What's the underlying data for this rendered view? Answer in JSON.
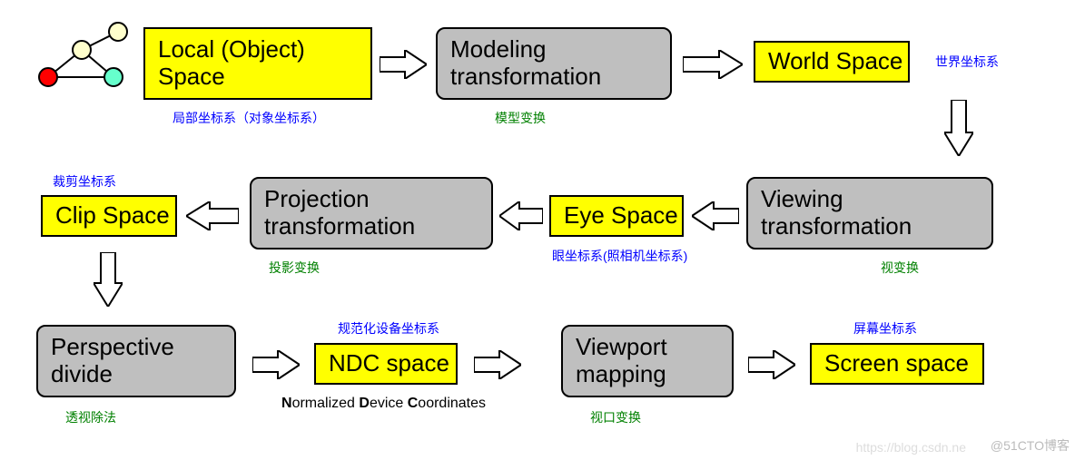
{
  "nodes": {
    "local": {
      "label": "Local (Object)\nSpace",
      "caption": "局部坐标系（对象坐标系）",
      "caption_color": "blue"
    },
    "modeling": {
      "label": "Modeling\ntransformation",
      "caption": "模型变换",
      "caption_color": "green"
    },
    "world": {
      "label": "World Space",
      "caption": "世界坐标系",
      "caption_color": "blue"
    },
    "viewing": {
      "label": "Viewing\ntransformation",
      "caption": "视变换",
      "caption_color": "green"
    },
    "eye": {
      "label": "Eye Space",
      "caption": "眼坐标系(照相机坐标系)",
      "caption_color": "blue"
    },
    "projection": {
      "label": "Projection\ntransformation",
      "caption": "投影变换",
      "caption_color": "green"
    },
    "clip": {
      "label": "Clip Space",
      "caption": "裁剪坐标系",
      "caption_color": "blue"
    },
    "perspective": {
      "label": "Perspective\ndivide",
      "caption": "透视除法",
      "caption_color": "green"
    },
    "ndc": {
      "label": "NDC space",
      "caption": "规范化设备坐标系",
      "caption_color": "blue",
      "sub": "Normalized Device Coordinates"
    },
    "viewport": {
      "label": "Viewport\nmapping",
      "caption": "视口变换",
      "caption_color": "green"
    },
    "screen": {
      "label": "Screen space",
      "caption": "屏幕坐标系",
      "caption_color": "blue"
    }
  },
  "watermarks": {
    "cto": "@51CTO博客",
    "csdn": "https://blog.csdn.ne"
  }
}
